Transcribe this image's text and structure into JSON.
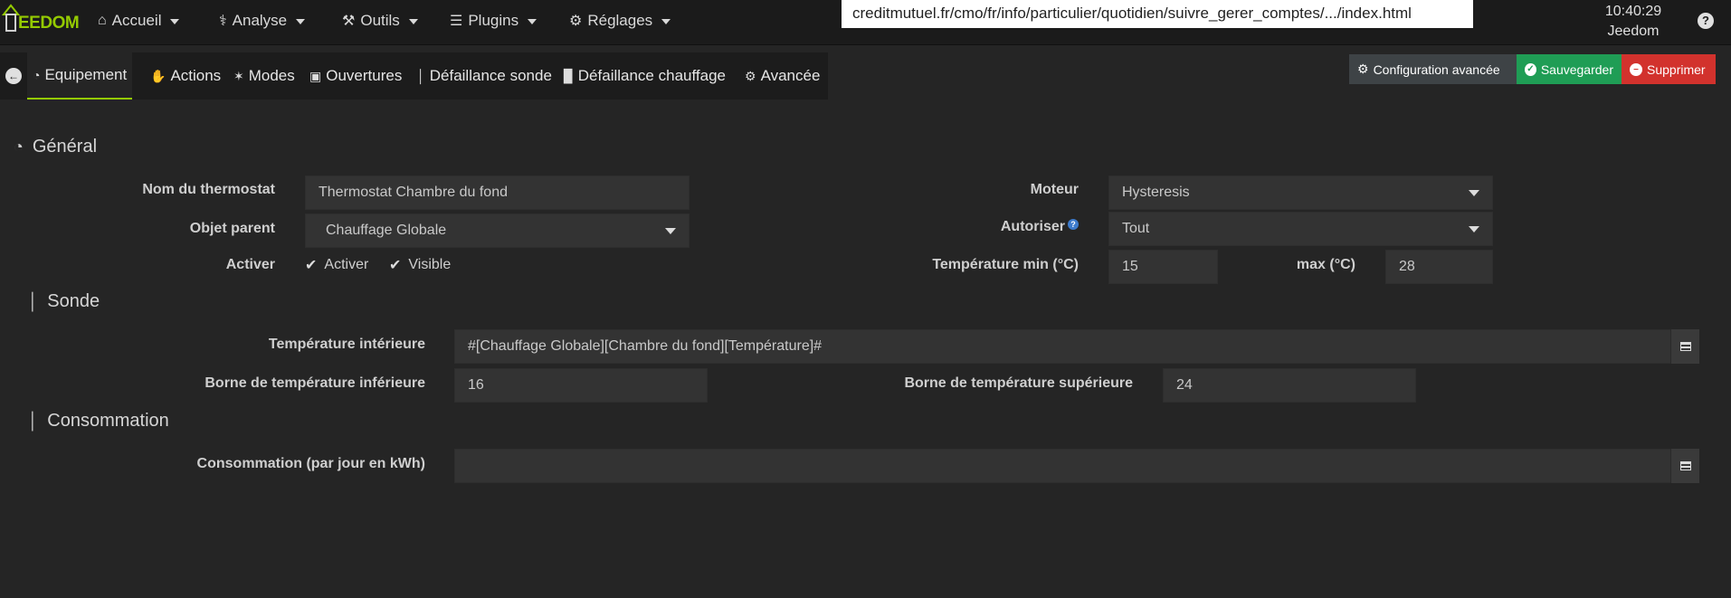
{
  "navbar": {
    "logo_text": "EEDOM",
    "items": [
      {
        "icon": "home-icon",
        "glyph": "⌂",
        "label": "Accueil"
      },
      {
        "icon": "stethoscope-icon",
        "glyph": "⚕",
        "label": "Analyse"
      },
      {
        "icon": "wrench-icon",
        "glyph": "⚒",
        "label": "Outils"
      },
      {
        "icon": "tasks-icon",
        "glyph": "☰",
        "label": "Plugins"
      },
      {
        "icon": "gear-icon",
        "glyph": "⚙",
        "label": "Réglages"
      }
    ],
    "url": "creditmutuel.fr/cmo/fr/info/particulier/quotidien/suivre_gerer_comptes/.../index.html",
    "time": "10:40:29",
    "user": "Jeedom",
    "help": "?"
  },
  "tabs": [
    {
      "icon": "dashboard-icon",
      "glyph": "◔",
      "label": "Equipement",
      "active": true
    },
    {
      "icon": "hand-icon",
      "glyph": "✋",
      "label": "Actions"
    },
    {
      "icon": "modes-icon",
      "glyph": "✶",
      "label": "Modes"
    },
    {
      "icon": "window-icon",
      "glyph": "▣",
      "label": "Ouvertures"
    },
    {
      "icon": "thermometer-icon",
      "glyph": "│",
      "label": "Défaillance sonde"
    },
    {
      "icon": "heater-icon",
      "glyph": "▉",
      "label": "Défaillance chauffage"
    },
    {
      "icon": "gear-icon",
      "glyph": "⚙",
      "label": "Avancée"
    }
  ],
  "actions": {
    "config": "Configuration avancée",
    "save": "Sauvegarder",
    "delete": "Supprimer"
  },
  "general": {
    "title": "Général",
    "name_label": "Nom du thermostat",
    "name_value": "Thermostat Chambre du fond",
    "parent_label": "Objet parent",
    "parent_value": "Chauffage Globale",
    "activate_label": "Activer",
    "activate_check": "Activer",
    "visible_check": "Visible",
    "engine_label": "Moteur",
    "engine_value": "Hysteresis",
    "allow_label": "Autoriser",
    "allow_value": "Tout",
    "tmin_label": "Température min (°C)",
    "tmin_value": "15",
    "tmax_label": "max (°C)",
    "tmax_value": "28"
  },
  "sonde": {
    "title": "Sonde",
    "indoor_label": "Température intérieure",
    "indoor_value": "#[Chauffage Globale][Chambre du fond][Température]#",
    "lower_label": "Borne de température inférieure",
    "lower_value": "16",
    "upper_label": "Borne de température supérieure",
    "upper_value": "24"
  },
  "conso": {
    "title": "Consommation",
    "label": "Consommation (par jour en kWh)",
    "value": ""
  }
}
